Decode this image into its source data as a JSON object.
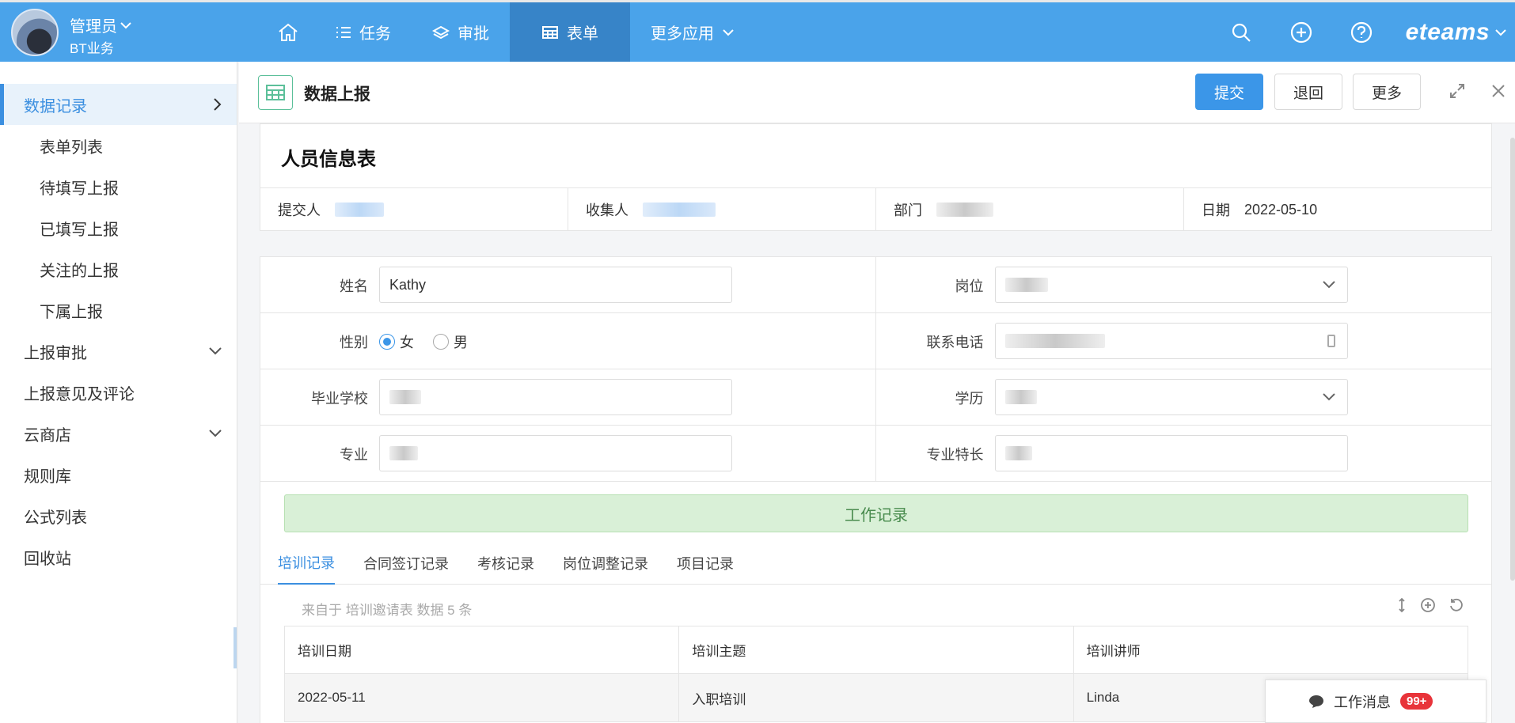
{
  "user": {
    "name": "管理员",
    "org": "BT业务"
  },
  "nav": {
    "home": "home",
    "tasks": "任务",
    "approval": "审批",
    "forms": "表单",
    "more": "更多应用"
  },
  "brand": "eteams",
  "sidebar": {
    "items": [
      {
        "label": "数据记录",
        "active": true
      },
      {
        "label": "表单列表"
      },
      {
        "label": "待填写上报"
      },
      {
        "label": "已填写上报"
      },
      {
        "label": "关注的上报"
      },
      {
        "label": "下属上报"
      },
      {
        "label": "上报审批"
      },
      {
        "label": "上报意见及评论"
      },
      {
        "label": "云商店"
      },
      {
        "label": "规则库"
      },
      {
        "label": "公式列表"
      },
      {
        "label": "回收站"
      }
    ]
  },
  "header": {
    "title": "数据上报",
    "submit": "提交",
    "back": "退回",
    "more": "更多"
  },
  "form": {
    "title": "人员信息表",
    "info": {
      "submitter_label": "提交人",
      "collector_label": "收集人",
      "dept_label": "部门",
      "date_label": "日期",
      "date_value": "2022-05-10"
    },
    "fields": {
      "name_label": "姓名",
      "name_value": "Kathy",
      "position_label": "岗位",
      "gender_label": "性别",
      "gender_female": "女",
      "gender_male": "男",
      "phone_label": "联系电话",
      "school_label": "毕业学校",
      "education_label": "学历",
      "major_label": "专业",
      "specialty_label": "专业特长"
    },
    "work_banner": "工作记录",
    "tabs": [
      "培训记录",
      "合同签订记录",
      "考核记录",
      "岗位调整记录",
      "项目记录"
    ],
    "source_text": "来自于 培训邀请表 数据 5 条",
    "table": {
      "headers": [
        "培训日期",
        "培训主题",
        "培训讲师"
      ],
      "rows": [
        [
          "2022-05-11",
          "入职培训",
          "Linda"
        ]
      ]
    }
  },
  "message": {
    "label": "工作消息",
    "badge": "99+"
  },
  "colors": {
    "primary": "#4aa3ea",
    "accent": "#3b96e8",
    "banner": "#d9f0d7",
    "badge": "#e8343a"
  }
}
